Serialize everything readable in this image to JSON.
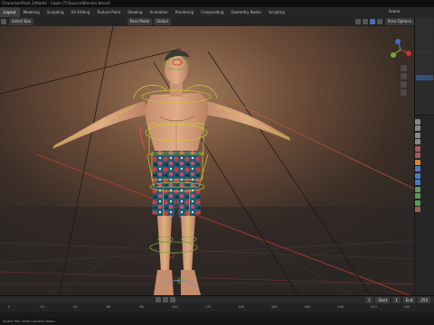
{
  "window": {
    "title": "Character\\Pack 2\\Model - Copie [T:\\Source\\Blender.blend]"
  },
  "workspaces": [
    "Layout",
    "Modeling",
    "Sculpting",
    "UV Editing",
    "Texture Paint",
    "Shading",
    "Animation",
    "Rendering",
    "Compositing",
    "Geometry Nodes",
    "Scripting"
  ],
  "active_workspace_index": 0,
  "scene": {
    "name": "Scene"
  },
  "viewport": {
    "select_mode": "Select Box",
    "mode": "Pose Mode",
    "pivot": "Global",
    "options_label": "Pose Options"
  },
  "timeline": {
    "current_frame": "1",
    "start_label": "Start",
    "start": "1",
    "end_label": "End",
    "end": "250",
    "ticks": [
      "0",
      "20",
      "40",
      "60",
      "80",
      "100",
      "120",
      "140",
      "160",
      "180",
      "200",
      "220",
      "240"
    ]
  },
  "status": {
    "text": "Select   Pan View   Context Menu"
  },
  "colors": {
    "accent": "#4772b3",
    "bone": "#c9c93a",
    "xaxis": "#c0392b",
    "yaxis": "#7ba632",
    "zaxis": "#3e6fc4"
  }
}
